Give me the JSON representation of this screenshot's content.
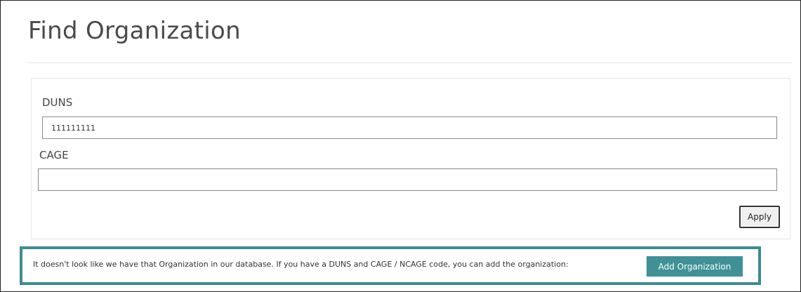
{
  "page": {
    "title": "Find Organization"
  },
  "form": {
    "duns_label": "DUNS",
    "duns_value": "111111111",
    "cage_label": "CAGE",
    "cage_value": "",
    "apply_label": "Apply"
  },
  "notice": {
    "message": "It doesn't look like we have that Organization in our database. If you have a DUNS and CAGE / NCAGE code, you can add the organization:",
    "button_label": "Add Organization",
    "border_color": "#3d8c92",
    "button_color": "#3f9196"
  }
}
